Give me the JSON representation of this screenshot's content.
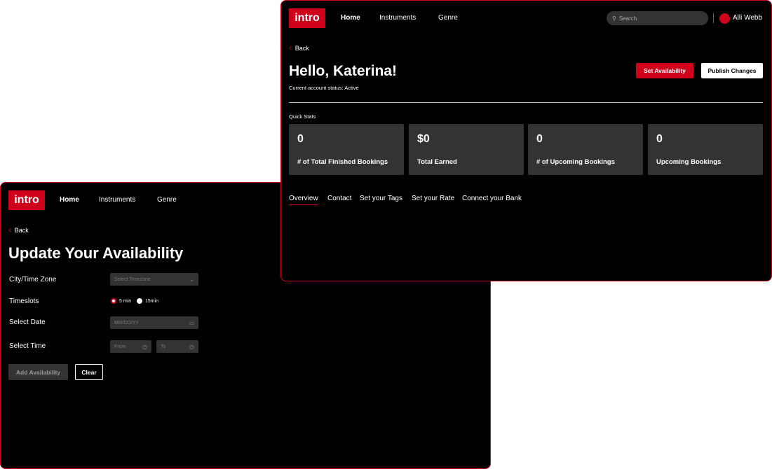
{
  "colors": {
    "brand": "#d0021b",
    "card": "#333333"
  },
  "availability": {
    "logo": "intro",
    "nav": [
      "Home",
      "Instruments",
      "Genre"
    ],
    "back": "Back",
    "title": "Update Your Availability",
    "fields": {
      "timezone_label": "City/Time Zone",
      "timezone_placeholder": "Select Timezone",
      "timeslots_label": "Timeslots",
      "slot_5": "5 min",
      "slot_15": "15min",
      "date_label": "Select Date",
      "date_placeholder": "MM/DD/YY",
      "time_label": "Select Time",
      "from_placeholder": "From",
      "to_placeholder": "To"
    },
    "add_button": "Add Availability",
    "clear_button": "Clear"
  },
  "dashboard": {
    "logo": "intro",
    "nav": [
      "Home",
      "Instruments",
      "Genre"
    ],
    "search_placeholder": "Search",
    "user": "Alli Webb",
    "back": "Back",
    "title": "Hello, Katerina!",
    "status": "Current account status: Active",
    "set_availability": "Set Availability",
    "publish": "Publish Changes",
    "quick_stats": "Quick Stats",
    "stats": [
      {
        "value": "0",
        "label": "# of Total Finished Bookings"
      },
      {
        "value": "$0",
        "label": "Total Earned"
      },
      {
        "value": "0",
        "label": "# of Upcoming Bookings"
      },
      {
        "value": "0",
        "label": "Upcoming Bookings"
      }
    ],
    "tabs": [
      "Overview",
      "Contact",
      "Set your Tags",
      "Set your Rate",
      "Connect your Bank"
    ],
    "active_tab": "Overview"
  }
}
